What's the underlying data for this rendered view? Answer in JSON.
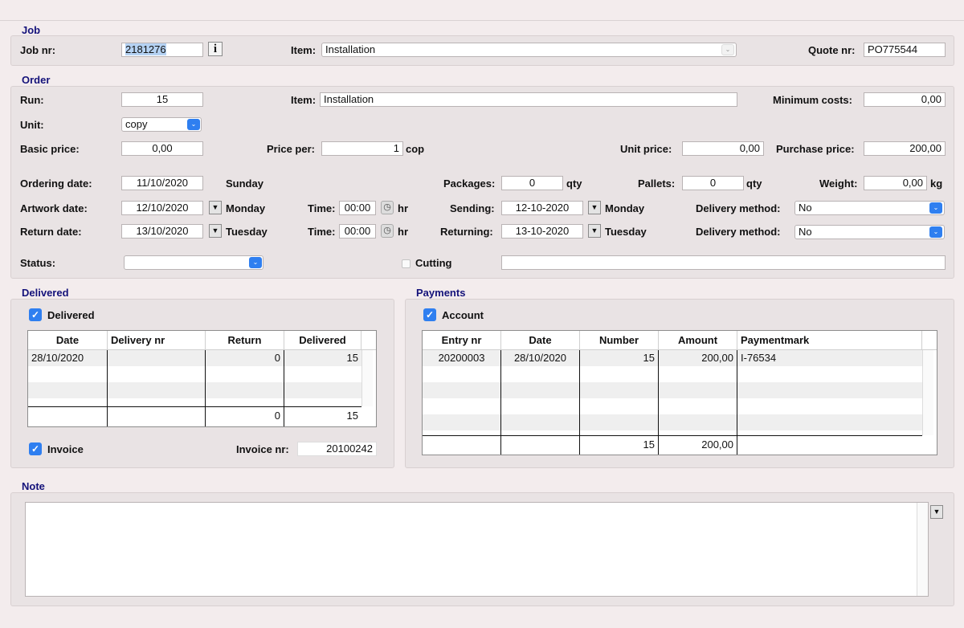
{
  "job": {
    "section_title": "Job",
    "job_nr_label": "Job nr:",
    "job_nr_value": "2181276",
    "info_label": "i",
    "item_label": "Item:",
    "item_value": "Installation",
    "quote_label": "Quote nr:",
    "quote_value": "PO775544"
  },
  "order": {
    "section_title": "Order",
    "run_label": "Run:",
    "run_value": "15",
    "item_label": "Item:",
    "item_value": "Installation",
    "min_costs_label": "Minimum costs:",
    "min_costs_value": "0,00",
    "unit_label": "Unit:",
    "unit_value": "copy",
    "basic_price_label": "Basic price:",
    "basic_price_value": "0,00",
    "price_per_label": "Price per:",
    "price_per_value": "1",
    "price_per_unit": "cop",
    "unit_price_label": "Unit price:",
    "unit_price_value": "0,00",
    "purchase_price_label": "Purchase price:",
    "purchase_price_value": "200,00",
    "ordering_date_label": "Ordering date:",
    "ordering_date_value": "11/10/2020",
    "ordering_day": "Sunday",
    "packages_label": "Packages:",
    "packages_value": "0",
    "qty_unit": "qty",
    "pallets_label": "Pallets:",
    "pallets_value": "0",
    "weight_label": "Weight:",
    "weight_value": "0,00",
    "weight_unit": "kg",
    "artwork_date_label": "Artwork date:",
    "artwork_date_value": "12/10/2020",
    "artwork_day": "Monday",
    "time_label": "Time:",
    "artwork_time": "00:00",
    "hr_unit": "hr",
    "sending_label": "Sending:",
    "sending_value": "12-10-2020",
    "sending_day": "Monday",
    "delivery_method_label": "Delivery method:",
    "delivery_method_1": "No",
    "return_date_label": "Return date:",
    "return_date_value": "13/10/2020",
    "return_day": "Tuesday",
    "return_time": "00:00",
    "returning_label": "Returning:",
    "returning_value": "13-10-2020",
    "returning_day": "Tuesday",
    "delivery_method_2": "No",
    "status_label": "Status:",
    "status_value": "",
    "cutting_label": "Cutting",
    "cutting_value": ""
  },
  "delivered": {
    "section_title": "Delivered",
    "checkbox_label": "Delivered",
    "columns": [
      "Date",
      "Delivery nr",
      "Return",
      "Delivered"
    ],
    "rows": [
      {
        "date": "28/10/2020",
        "delivery_nr": "",
        "return": "0",
        "delivered": "15"
      }
    ],
    "totals": {
      "return": "0",
      "delivered": "15"
    },
    "invoice_label": "Invoice",
    "invoice_nr_label": "Invoice nr:",
    "invoice_nr_value": "20100242"
  },
  "payments": {
    "section_title": "Payments",
    "checkbox_label": "Account",
    "columns": [
      "Entry nr",
      "Date",
      "Number",
      "Amount",
      "Paymentmark"
    ],
    "rows": [
      {
        "entry_nr": "20200003",
        "date": "28/10/2020",
        "number": "15",
        "amount": "200,00",
        "paymentmark": "I-76534"
      }
    ],
    "totals": {
      "number": "15",
      "amount": "200,00"
    }
  },
  "note": {
    "section_title": "Note",
    "value": ""
  },
  "icons": {
    "checkmark": "✓",
    "select_arrow": "⌄",
    "dropdown_arrow": "▼",
    "clock": "◷"
  },
  "colors": {
    "section_title": "#14127a",
    "accent_blue": "#2f7ff0",
    "background": "#f3eced",
    "panel": "#e9e3e4"
  }
}
